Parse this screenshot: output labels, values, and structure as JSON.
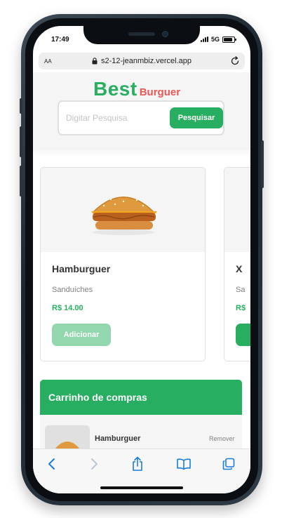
{
  "status_bar": {
    "time": "17:49",
    "network": "5G",
    "battery_level": 0.85
  },
  "browser": {
    "text_size_label": "AA",
    "url": "s2-12-jeanmbiz.vercel.app"
  },
  "header": {
    "logo_primary": "Best",
    "logo_secondary": "Burguer",
    "search": {
      "placeholder": "Digitar Pesquisa",
      "value": "",
      "button_label": "Pesquisar"
    }
  },
  "products": [
    {
      "name": "Hamburguer",
      "category": "Sanduíches",
      "price": "R$ 14.00",
      "button_label": "Adicionar"
    },
    {
      "name": "X",
      "category": "Sa",
      "price": "R$",
      "button_label": ""
    }
  ],
  "cart": {
    "title": "Carrinho de compras",
    "items": [
      {
        "name": "Hamburguer",
        "remove_label": "Remover"
      }
    ]
  },
  "toolbar": {
    "icons": [
      "back-icon",
      "forward-icon",
      "share-icon",
      "bookmarks-icon",
      "tabs-icon"
    ],
    "accent": "#1a7de0"
  },
  "colors": {
    "brand_green": "#27ae60",
    "brand_red": "#eb5757",
    "button_disabled_green": "#93d7af"
  }
}
